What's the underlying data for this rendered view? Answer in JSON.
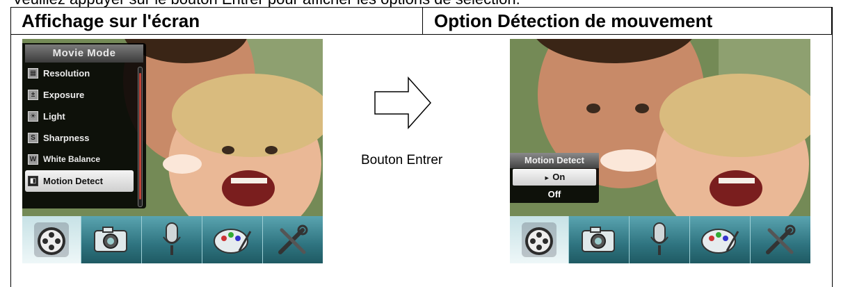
{
  "top_text": "Veuillez appuyer sur le bouton Entrer pour afficher les options de sélection.",
  "headers": {
    "left": "Affichage sur l'écran",
    "right": "Option Détection de mouvement"
  },
  "menu": {
    "title": "Movie Mode",
    "items": [
      {
        "label": "Resolution",
        "icon": "resolution-icon"
      },
      {
        "label": "Exposure",
        "icon": "exposure-icon"
      },
      {
        "label": "Light",
        "icon": "light-icon"
      },
      {
        "label": "Sharpness",
        "icon": "sharpness-icon"
      },
      {
        "label": "White Balance",
        "icon": "white-balance-icon"
      },
      {
        "label": "Motion Detect",
        "icon": "motion-detect-icon"
      }
    ],
    "selected": "Motion Detect"
  },
  "arrow_label": "Bouton Entrer",
  "submenu": {
    "title": "Motion Detect",
    "options": [
      "On",
      "Off"
    ],
    "selected": "On",
    "marker": "►"
  },
  "toolbar": [
    "movie-mode-icon",
    "camera-mode-icon",
    "voice-record-icon",
    "playback-icon",
    "settings-tools-icon"
  ],
  "colors": {
    "toolbar": "#2f7480",
    "scrollbar": "#c2453a",
    "menu_bg": "#000000"
  }
}
